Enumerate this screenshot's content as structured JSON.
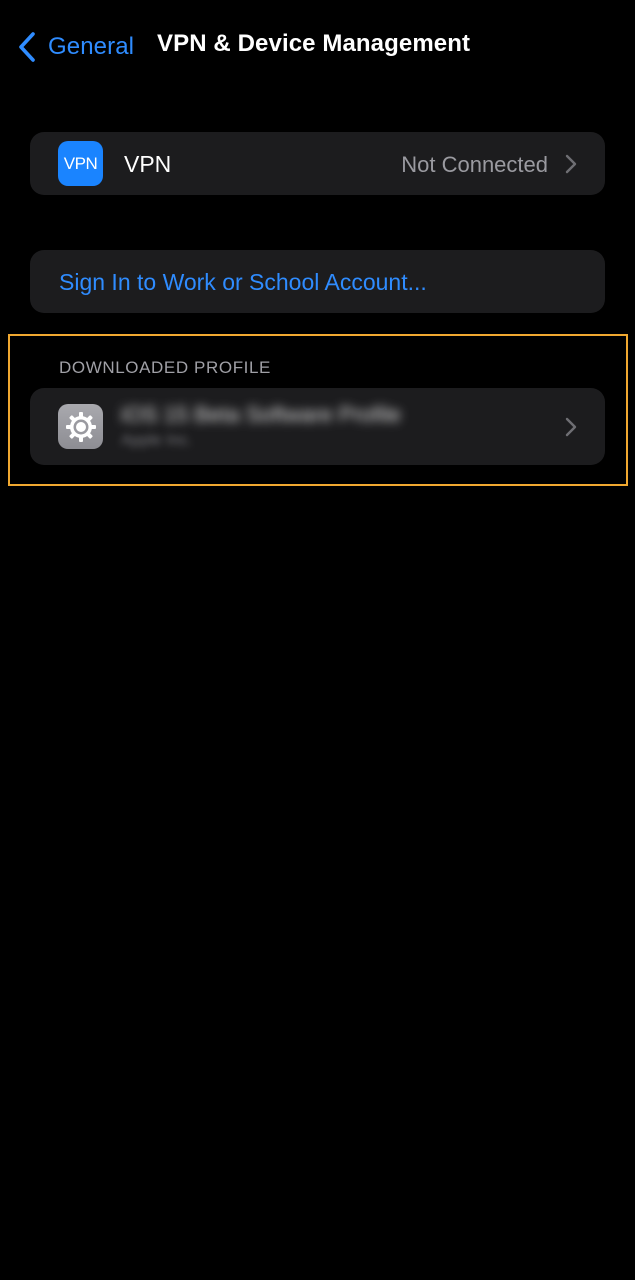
{
  "nav": {
    "back_label": "General",
    "title": "VPN & Device Management"
  },
  "vpn": {
    "badge_text": "VPN",
    "title": "VPN",
    "status": "Not Connected"
  },
  "sign_in": {
    "label": "Sign In to Work or School Account..."
  },
  "downloaded_profile": {
    "section_header": "DOWNLOADED PROFILE",
    "profile_name": "iOS 15 Beta Software Profile",
    "profile_sub": "Apple Inc."
  },
  "colors": {
    "background": "#000000",
    "cell": "#1c1c1e",
    "accent_blue": "#2f8cff",
    "secondary_text": "#9a9aa0",
    "highlight": "#f0a830"
  },
  "icons": {
    "back": "chevron-left-icon",
    "vpn": "vpn-badge-icon",
    "profile": "gear-icon",
    "disclosure": "chevron-right-icon"
  }
}
